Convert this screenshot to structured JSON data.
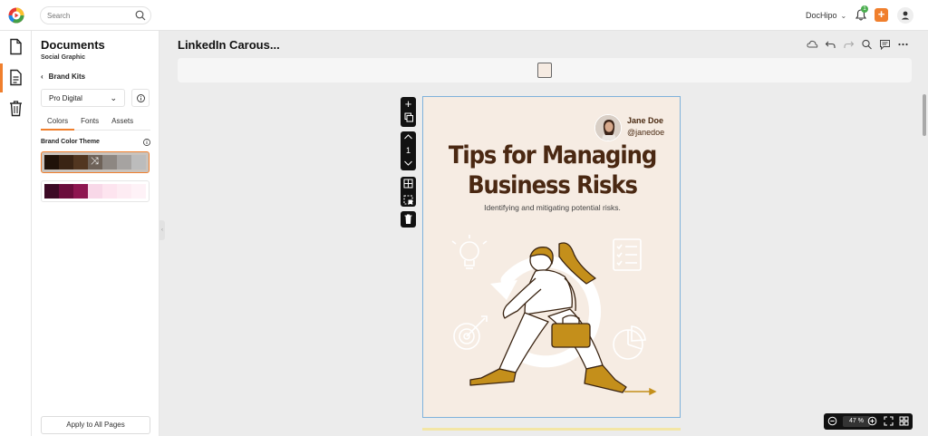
{
  "search": {
    "placeholder": "Search"
  },
  "account": {
    "name": "DocHipo",
    "notifications": "1"
  },
  "panel": {
    "title": "Documents",
    "subtitle": "Social Graphic",
    "back_label": "Brand Kits",
    "kit_selected": "Pro Digital",
    "tabs": [
      {
        "label": "Colors",
        "active": true
      },
      {
        "label": "Fonts",
        "active": false
      },
      {
        "label": "Assets",
        "active": false
      }
    ],
    "theme_heading": "Brand Color Theme",
    "palettes": [
      {
        "selected": true,
        "colors": [
          "#1f1209",
          "#3a2414",
          "#523620",
          "#6e6258",
          "#8d8782",
          "#a6a3a1",
          "#bcbcbc"
        ]
      },
      {
        "selected": false,
        "colors": [
          "#3c0a25",
          "#6b0d3c",
          "#8e1650",
          "#f8d8e8",
          "#fde4ef",
          "#fdecf3",
          "#fef2f7"
        ]
      }
    ],
    "apply_label": "Apply to All Pages"
  },
  "document": {
    "title": "LinkedIn Carous..."
  },
  "page_tools": {
    "page_number": "1"
  },
  "canvas": {
    "author_name": "Jane Doe",
    "author_handle": "@janedoe",
    "headline_line1": "Tips for Managing",
    "headline_line2": "Business Risks",
    "subheadline": "Identifying and mitigating potential risks.",
    "background": "#f6ece3",
    "accent": "#c48f1b",
    "headline_color": "#4a2812"
  },
  "zoom": {
    "value": "47 %"
  },
  "colors": {
    "brand_orange": "#f07f2d"
  }
}
